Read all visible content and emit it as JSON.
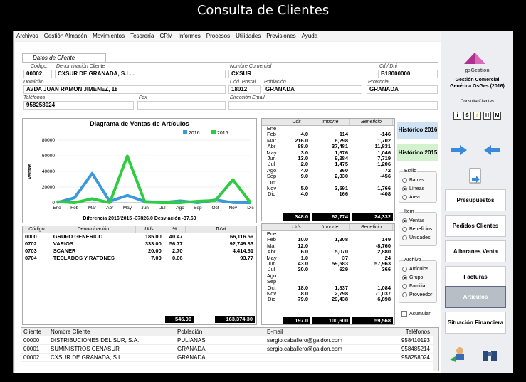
{
  "window_title": "Consulta de Clientes",
  "menu": [
    "Archivos",
    "Gestión Almacén",
    "Movimientos",
    "Tesorería",
    "CRM",
    "Informes",
    "Procesos",
    "Utilidades",
    "Previsiones",
    "Ayuda"
  ],
  "client": {
    "section_label": "Datos de Cliente",
    "codigo_label": "Código:",
    "codigo": "00002",
    "denominacion_label": "Denominación Cliente",
    "denominacion": "CXSUR DE GRANADA, S.L...",
    "nombre_comercial_label": "Nombre Comercial",
    "nombre_comercial": "CXSUR",
    "cif_label": "Cif / Dni",
    "cif": "B18000000",
    "domicilio_label": "Domicilio",
    "domicilio": "AVDA JUAN RAMON JIMENEZ, 18",
    "cp_label": "Cód. Postal",
    "cp": "18012",
    "poblacion_label": "Población",
    "poblacion": "GRANADA",
    "provincia_label": "Provincia",
    "provincia": "GRANADA",
    "telefonos_label": "Teléfonos",
    "telefonos": "958258024",
    "fax_label": "Fax",
    "fax": "",
    "email_label": "Dirección Email",
    "email": ""
  },
  "chart_data": {
    "type": "line",
    "title": "Diagrama de Ventas de Artículos",
    "categories": [
      "Ene",
      "Feb",
      "Mar",
      "Abr",
      "May",
      "Jun",
      "Jul",
      "Ago",
      "Sep",
      "Oct",
      "Nov",
      "Dic"
    ],
    "ylabel": "Ventas",
    "ylim": [
      0,
      80000
    ],
    "yticks": [
      "80000",
      "60000",
      "40000",
      "20000",
      "0"
    ],
    "series": [
      {
        "name": "2016",
        "color": "#3a9ad9",
        "values": [
          114,
          6298,
          37481,
          1676,
          9284,
          1475,
          360,
          2330,
          0,
          3591,
          166,
          0
        ]
      },
      {
        "name": "2015",
        "color": "#2ecc40",
        "values": [
          1208,
          0,
          5070,
          37,
          59583,
          629,
          0,
          0,
          1837,
          2798,
          29438,
          0
        ]
      }
    ],
    "footer": "Diferencia 2016/2015  -37826.0  Desviación  -37.60"
  },
  "ventas_2016": {
    "headers": [
      "Uds",
      "Importe",
      "Beneficio"
    ],
    "rows": [
      [
        "Ene",
        "",
        "",
        ""
      ],
      [
        "Feb",
        "4.0",
        "114",
        "-146"
      ],
      [
        "Mar",
        "216.0",
        "6,298",
        "1,702"
      ],
      [
        "Abr",
        "88.0",
        "37,481",
        "11,831"
      ],
      [
        "May",
        "3.0",
        "1,676",
        "1,046"
      ],
      [
        "Jun",
        "13.0",
        "9,284",
        "7,719"
      ],
      [
        "Jul",
        "2.0",
        "1,475",
        "1,206"
      ],
      [
        "Ago",
        "4.0",
        "360",
        "72"
      ],
      [
        "Sep",
        "9.0",
        "2,330",
        "-456"
      ],
      [
        "Oct",
        "",
        "",
        ""
      ],
      [
        "Nov",
        "5.0",
        "3,591",
        "1,766"
      ],
      [
        "Dic",
        "4.0",
        "166",
        "-408"
      ]
    ],
    "totals": [
      "348.0",
      "62,774",
      "24,332"
    ]
  },
  "ventas_2015": {
    "headers": [
      "Uds",
      "Importe",
      "Beneficio"
    ],
    "rows": [
      [
        "Ene",
        "",
        "",
        ""
      ],
      [
        "Feb",
        "10.0",
        "1,208",
        "149"
      ],
      [
        "Mar",
        "12.0",
        "",
        "-8,760"
      ],
      [
        "Abr",
        "6.0",
        "5,070",
        "2,880"
      ],
      [
        "May",
        "1.0",
        "37",
        "24"
      ],
      [
        "Jun",
        "43.0",
        "59,583",
        "57,963"
      ],
      [
        "Jul",
        "20.0",
        "629",
        "366"
      ],
      [
        "Ago",
        "",
        "",
        ""
      ],
      [
        "Sep",
        "",
        "",
        ""
      ],
      [
        "Oct",
        "18.0",
        "1,837",
        "1,084"
      ],
      [
        "Nov",
        "8.0",
        "2,798",
        "-1,037"
      ],
      [
        "Dic",
        "79.0",
        "29,438",
        "6,898"
      ]
    ],
    "totals": [
      "197.0",
      "100,600",
      "59,568"
    ]
  },
  "articulos": {
    "headers": [
      "Código",
      "Denominación",
      "Uds.",
      "%",
      "Total"
    ],
    "rows": [
      [
        "0000",
        "GRUPO GENERICO",
        "185.00",
        "40.47",
        "66,116.59"
      ],
      [
        "0702",
        "VARIOS",
        "333.00",
        "56.77",
        "92,749.33"
      ],
      [
        "0703",
        "SCANER",
        "20.00",
        "2.70",
        "4,414.61"
      ],
      [
        "0704",
        "TECLADOS Y RATONES",
        "7.00",
        "0.06",
        "93.77"
      ]
    ],
    "total_uds": "545.00",
    "total": "163,374.30"
  },
  "historico": {
    "h2016": "Histórico 2016",
    "h2015": "Histórico 2015"
  },
  "estilo": {
    "title": "Estilo",
    "options": [
      "Barras",
      "Líneas",
      "Área"
    ],
    "selected": 1
  },
  "item": {
    "title": "Item",
    "options": [
      "Ventas",
      "Beneficios",
      "Unidades"
    ],
    "selected": 0
  },
  "archivo": {
    "title": "Archivo",
    "options": [
      "Artículos",
      "Grupo",
      "Familia",
      "Proveedor"
    ],
    "selected": 1
  },
  "acumular_label": "Acumular",
  "clientes": {
    "headers": [
      "Cliente",
      "Nombre Cliente",
      "Población",
      "E-mail",
      "Teléfonos"
    ],
    "rows": [
      [
        "00000",
        "DISTRIBUCIONES DEL SUR, S.A.",
        "PULIANAS",
        "sergio.caballero@galdon.com",
        "958410193"
      ],
      [
        "00001",
        "SUMINISTROS CENASUR",
        "GRANADA",
        "sergio.caballero@galdon.com",
        "958485214"
      ],
      [
        "00002",
        "CXSUR DE GRANADA, S.L...",
        "GRANADA",
        "",
        "958258024"
      ]
    ]
  },
  "sidebar": {
    "brand": "gsGestion",
    "app_name": "Gestión Comercial Genérica GsGes (2016)",
    "subtitle": "Consulta Clientes",
    "small_icons": [
      "i",
      "$",
      "⚡",
      "H",
      "M"
    ],
    "buttons": [
      "Presupuestos",
      "Pedidos Clientes",
      "Albaranes Venta",
      "Facturas",
      "Artículos",
      "Situación Financiera"
    ],
    "active": 4
  }
}
